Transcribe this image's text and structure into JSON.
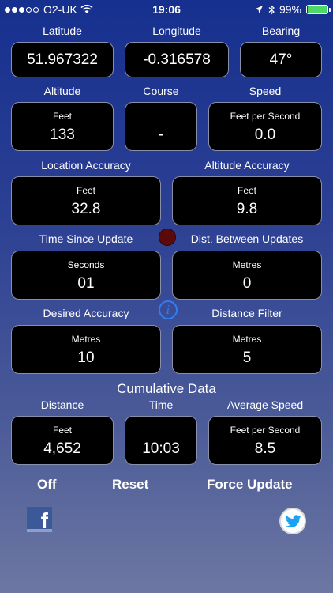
{
  "status_bar": {
    "carrier": "O2-UK",
    "time": "19:06",
    "battery": "99%",
    "battery_level": 0.99,
    "signal_bars_on": 3,
    "signal_bars_total": 5
  },
  "position": {
    "latitude_label": "Latitude",
    "latitude_value": "51.967322",
    "longitude_label": "Longitude",
    "longitude_value": "-0.316578",
    "bearing_label": "Bearing",
    "bearing_value": "47°"
  },
  "motion": {
    "altitude_label": "Altitude",
    "altitude_unit": "Feet",
    "altitude_value": "133",
    "course_label": "Course",
    "course_value": "-",
    "speed_label": "Speed",
    "speed_unit": "Feet per Second",
    "speed_value": "0.0"
  },
  "accuracy": {
    "location_label": "Location Accuracy",
    "location_unit": "Feet",
    "location_value": "32.8",
    "altitude_label": "Altitude Accuracy",
    "altitude_unit": "Feet",
    "altitude_value": "9.8"
  },
  "updates": {
    "time_label": "Time Since Update",
    "time_unit": "Seconds",
    "time_value": "01",
    "dist_label": "Dist. Between Updates",
    "dist_unit": "Metres",
    "dist_value": "0"
  },
  "settings": {
    "desired_label": "Desired Accuracy",
    "desired_unit": "Metres",
    "desired_value": "10",
    "filter_label": "Distance Filter",
    "filter_unit": "Metres",
    "filter_value": "5",
    "info_glyph": "i"
  },
  "cumulative": {
    "title": "Cumulative Data",
    "distance_label": "Distance",
    "distance_unit": "Feet",
    "distance_value": "4,652",
    "time_label": "Time",
    "time_value": "10:03",
    "avg_label": "Average Speed",
    "avg_unit": "Feet per Second",
    "avg_value": "8.5"
  },
  "actions": {
    "off": "Off",
    "reset": "Reset",
    "force_update": "Force Update"
  },
  "icons": {
    "facebook": "facebook-icon",
    "twitter": "twitter-icon",
    "facebook_glyph": "f"
  },
  "colors": {
    "indicator": "#5a0a0a",
    "info": "#2f7ef3",
    "battery": "#4cd964"
  }
}
